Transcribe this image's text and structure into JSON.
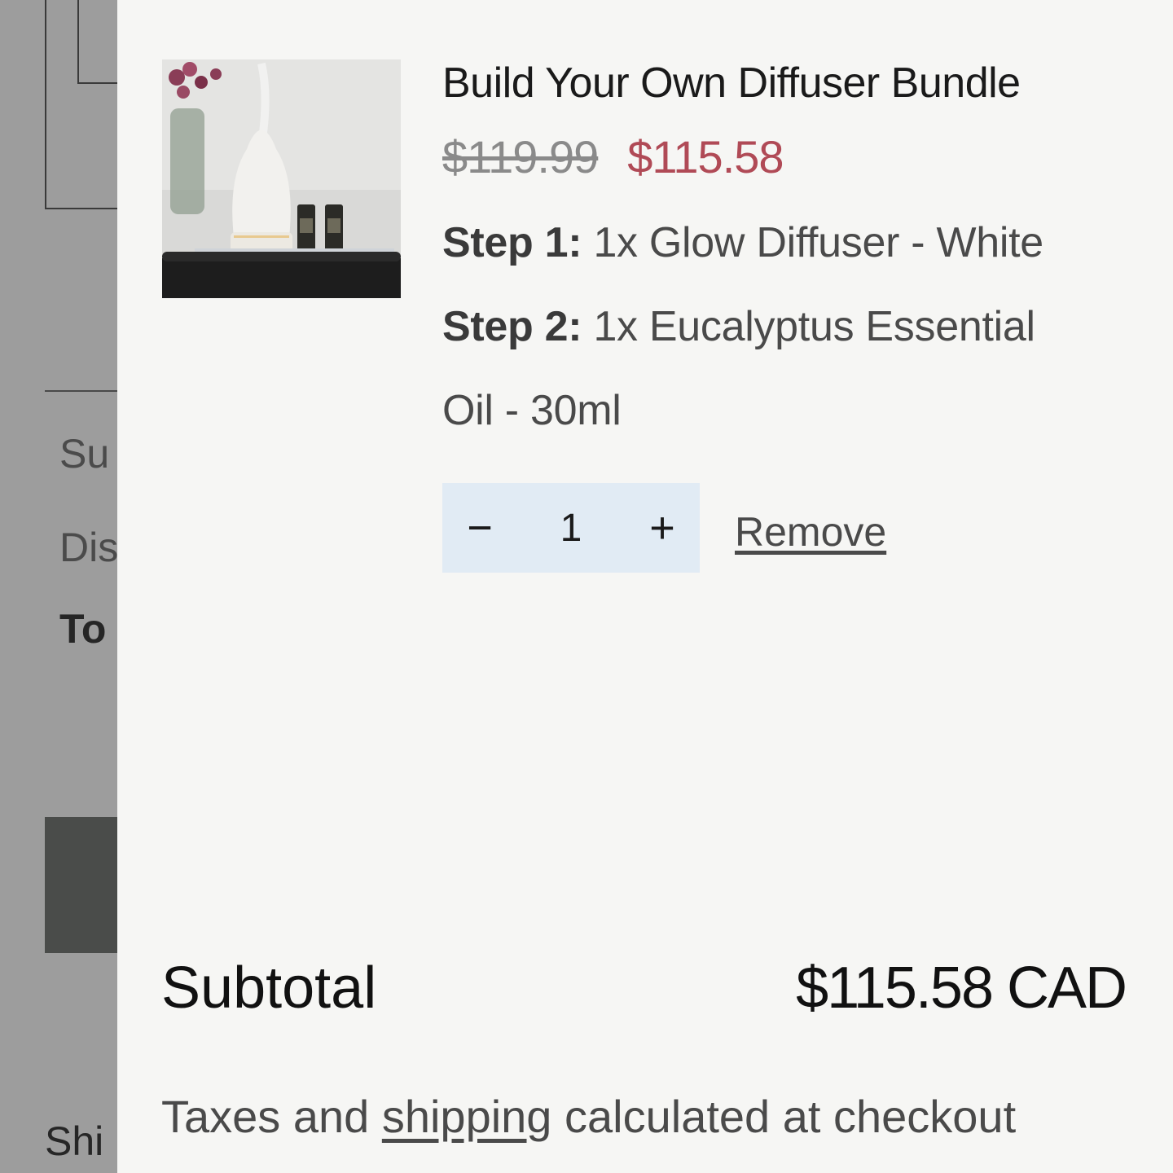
{
  "background": {
    "subtotal_partial": "Su",
    "discount_partial": "Dis",
    "total_partial": "To",
    "shipping_partial": "Shi"
  },
  "cart": {
    "item": {
      "title": "Build Your Own Diffuser Bundle",
      "price_original": "$119.99",
      "price_sale": "$115.58",
      "step1_label": "Step 1:",
      "step1_value": "1x Glow Diffuser - White",
      "step2_label": "Step 2:",
      "step2_value_line1": "1x Eucalyptus Essential",
      "step2_value_line2": "Oil - 30ml",
      "quantity": "1",
      "decrease_symbol": "−",
      "increase_symbol": "+",
      "remove_label": "Remove"
    },
    "subtotal_label": "Subtotal",
    "subtotal_value": "$115.58 CAD",
    "taxes_before": "Taxes and",
    "taxes_link": "shipping",
    "taxes_after": "calculated at checkout"
  },
  "colors": {
    "sale_price": "#b04a56",
    "qty_bg": "#e1ebf4",
    "drawer_bg": "#f6f6f4"
  }
}
